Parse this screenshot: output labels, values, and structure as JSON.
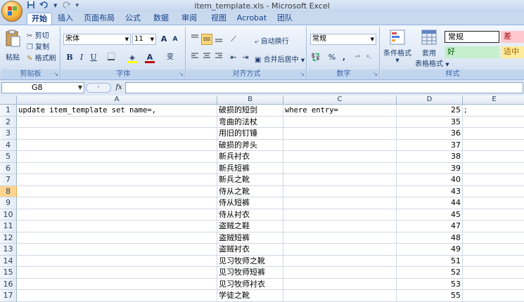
{
  "window": {
    "title": "item_template.xls - Microsoft Excel"
  },
  "qat": {
    "save_icon": "save-icon",
    "undo_icon": "undo-icon",
    "redo_icon": "redo-icon"
  },
  "tabs": [
    {
      "label": "开始",
      "active": true
    },
    {
      "label": "插入"
    },
    {
      "label": "页面布局"
    },
    {
      "label": "公式"
    },
    {
      "label": "数据"
    },
    {
      "label": "审阅"
    },
    {
      "label": "视图"
    },
    {
      "label": "Acrobat"
    },
    {
      "label": "团队"
    }
  ],
  "ribbon": {
    "clipboard": {
      "paste": "粘贴",
      "cut": "剪切",
      "copy": "复制",
      "format_painter": "格式刷",
      "label": "剪贴板"
    },
    "font": {
      "name": "宋体",
      "size": "11",
      "grow": "A",
      "shrink": "A",
      "bold": "B",
      "italic": "I",
      "underline": "U",
      "fill_letter": "A",
      "font_color_letter": "A",
      "phonetic": "变",
      "label": "字体",
      "font_color": "#c00000",
      "fill_color": "#ffff00"
    },
    "alignment": {
      "wrap": "自动换行",
      "merge": "合并后居中",
      "label": "对齐方式"
    },
    "number": {
      "format": "常规",
      "percent": "%",
      "comma": ",",
      "label": "数字"
    },
    "styles": {
      "conditional": "条件格式",
      "table_format_1": "套用",
      "table_format_2": "表格格式",
      "normal": "常规",
      "bad": "差",
      "good": "好",
      "neutral": "适中",
      "label": "样式",
      "bad_bg": "#ffc7ce",
      "bad_fg": "#9c0006",
      "good_bg": "#c6efce",
      "good_fg": "#006100",
      "neutral_bg": "#ffeb9c",
      "neutral_fg": "#9c6500"
    }
  },
  "formula_bar": {
    "name_box": "G8",
    "fx": "fx",
    "value": ""
  },
  "sheet": {
    "columns": [
      "A",
      "B",
      "C",
      "D",
      "E"
    ],
    "selected_row": 8,
    "rows": [
      {
        "n": "1",
        "a": "update item_template set name=,",
        "b": "破损的短剑",
        "c": "where entry=",
        "d": "25",
        "e": ";"
      },
      {
        "n": "2",
        "a": "",
        "b": "弯曲的法杖",
        "c": "",
        "d": "35",
        "e": ""
      },
      {
        "n": "3",
        "a": "",
        "b": "用旧的钉锤",
        "c": "",
        "d": "36",
        "e": ""
      },
      {
        "n": "4",
        "a": "",
        "b": "破损的斧头",
        "c": "",
        "d": "37",
        "e": ""
      },
      {
        "n": "5",
        "a": "",
        "b": "新兵衬衣",
        "c": "",
        "d": "38",
        "e": ""
      },
      {
        "n": "6",
        "a": "",
        "b": "新兵短裤",
        "c": "",
        "d": "39",
        "e": ""
      },
      {
        "n": "7",
        "a": "",
        "b": "新兵之靴",
        "c": "",
        "d": "40",
        "e": ""
      },
      {
        "n": "8",
        "a": "",
        "b": "侍从之靴",
        "c": "",
        "d": "43",
        "e": ""
      },
      {
        "n": "9",
        "a": "",
        "b": "侍从短裤",
        "c": "",
        "d": "44",
        "e": ""
      },
      {
        "n": "10",
        "a": "",
        "b": "侍从衬衣",
        "c": "",
        "d": "45",
        "e": ""
      },
      {
        "n": "11",
        "a": "",
        "b": "盗贼之鞋",
        "c": "",
        "d": "47",
        "e": ""
      },
      {
        "n": "12",
        "a": "",
        "b": "盗贼短裤",
        "c": "",
        "d": "48",
        "e": ""
      },
      {
        "n": "13",
        "a": "",
        "b": "盗贼衬衣",
        "c": "",
        "d": "49",
        "e": ""
      },
      {
        "n": "14",
        "a": "",
        "b": "见习牧师之靴",
        "c": "",
        "d": "51",
        "e": ""
      },
      {
        "n": "15",
        "a": "",
        "b": "见习牧师短裤",
        "c": "",
        "d": "52",
        "e": ""
      },
      {
        "n": "16",
        "a": "",
        "b": "见习牧师衬衣",
        "c": "",
        "d": "53",
        "e": ""
      },
      {
        "n": "17",
        "a": "",
        "b": "学徒之靴",
        "c": "",
        "d": "55",
        "e": ""
      }
    ]
  }
}
